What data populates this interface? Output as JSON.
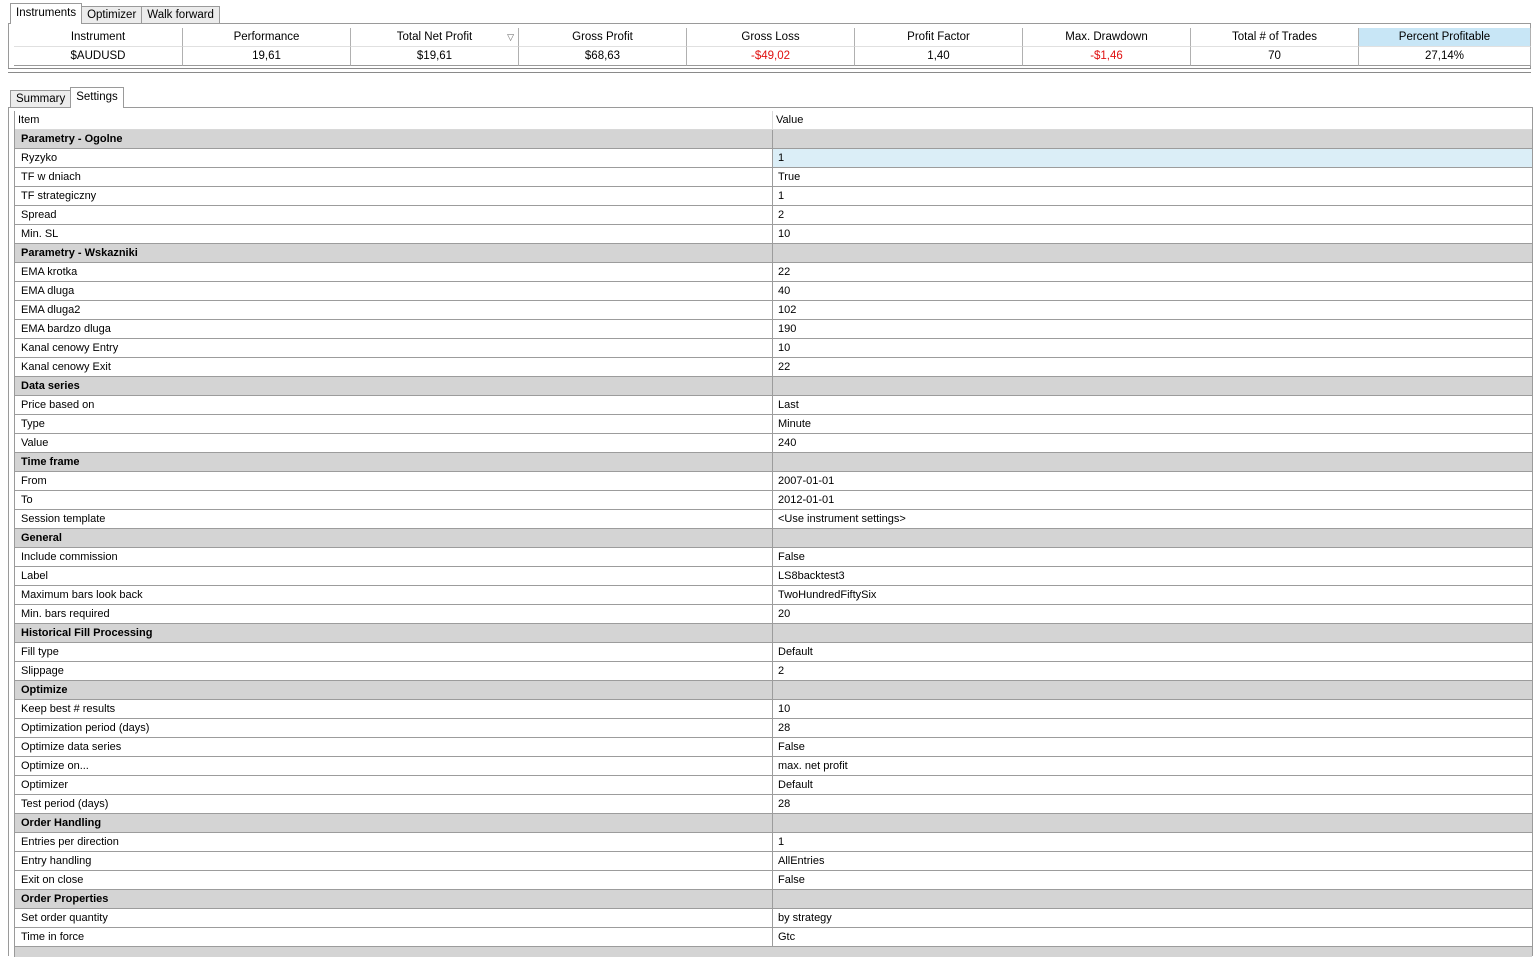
{
  "top_tabs": [
    "Instruments",
    "Optimizer",
    "Walk forward"
  ],
  "instruments": {
    "columns": [
      "Instrument",
      "Performance",
      "Total Net Profit",
      "Gross Profit",
      "Gross Loss",
      "Profit Factor",
      "Max. Drawdown",
      "Total # of Trades",
      "Percent Profitable"
    ],
    "sorted_column": "Total Net Profit",
    "selected_column": "Percent Profitable",
    "rows": [
      [
        "$AUDUSD",
        "19,61",
        "$19,61",
        "$68,63",
        "-$49,02",
        "1,40",
        "-$1,46",
        "70",
        "27,14%"
      ]
    ]
  },
  "lower_tabs": [
    "Summary",
    "Settings"
  ],
  "settings": {
    "header": {
      "item": "Item",
      "value": "Value"
    },
    "rows": [
      {
        "item": "Parametry - Ogolne",
        "value": "",
        "category": true
      },
      {
        "item": "Ryzyko",
        "value": "1",
        "selected": true
      },
      {
        "item": "TF w dniach",
        "value": "True"
      },
      {
        "item": "TF strategiczny",
        "value": "1"
      },
      {
        "item": "Spread",
        "value": "2"
      },
      {
        "item": "Min. SL",
        "value": "10"
      },
      {
        "item": "Parametry - Wskazniki",
        "value": "",
        "category": true
      },
      {
        "item": "EMA krotka",
        "value": "22"
      },
      {
        "item": "EMA dluga",
        "value": "40"
      },
      {
        "item": "EMA dluga2",
        "value": "102"
      },
      {
        "item": "EMA bardzo dluga",
        "value": "190"
      },
      {
        "item": "Kanal cenowy Entry",
        "value": "10"
      },
      {
        "item": "Kanal cenowy Exit",
        "value": "22"
      },
      {
        "item": "Data series",
        "value": "",
        "category": true
      },
      {
        "item": "Price based on",
        "value": "Last"
      },
      {
        "item": "Type",
        "value": "Minute"
      },
      {
        "item": "Value",
        "value": "240"
      },
      {
        "item": "Time frame",
        "value": "",
        "category": true
      },
      {
        "item": "From",
        "value": "2007-01-01"
      },
      {
        "item": "To",
        "value": "2012-01-01"
      },
      {
        "item": "Session template",
        "value": "<Use instrument settings>"
      },
      {
        "item": "General",
        "value": "",
        "category": true
      },
      {
        "item": "Include commission",
        "value": "False"
      },
      {
        "item": "Label",
        "value": "LS8backtest3"
      },
      {
        "item": "Maximum bars look back",
        "value": "TwoHundredFiftySix"
      },
      {
        "item": "Min. bars required",
        "value": "20"
      },
      {
        "item": "Historical Fill Processing",
        "value": "",
        "category": true
      },
      {
        "item": "Fill type",
        "value": "Default"
      },
      {
        "item": "Slippage",
        "value": "2"
      },
      {
        "item": "Optimize",
        "value": "",
        "category": true
      },
      {
        "item": "Keep best # results",
        "value": "10"
      },
      {
        "item": "Optimization period (days)",
        "value": "28"
      },
      {
        "item": "Optimize data series",
        "value": "False"
      },
      {
        "item": "Optimize on...",
        "value": "max. net profit"
      },
      {
        "item": "Optimizer",
        "value": "Default"
      },
      {
        "item": "Test period (days)",
        "value": "28"
      },
      {
        "item": "Order Handling",
        "value": "",
        "category": true
      },
      {
        "item": "Entries per direction",
        "value": "1"
      },
      {
        "item": "Entry handling",
        "value": "AllEntries"
      },
      {
        "item": "Exit on close",
        "value": "False"
      },
      {
        "item": "Order Properties",
        "value": "",
        "category": true
      },
      {
        "item": "Set order quantity",
        "value": "by strategy"
      },
      {
        "item": "Time in force",
        "value": "Gtc"
      }
    ]
  },
  "colors": {
    "negative": "#e01010",
    "category_bg": "#d4d4d4",
    "selected_header": "#c8e6f6",
    "selected_value": "#dbeef7"
  }
}
